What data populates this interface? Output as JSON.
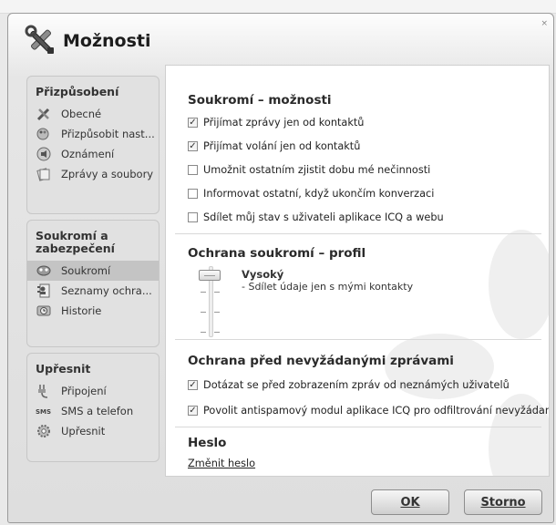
{
  "window": {
    "title": "Možnosti"
  },
  "sidebar": {
    "groups": [
      {
        "title": "Přizpůsobení",
        "items": [
          {
            "label": "Obecné",
            "icon": "tools-icon"
          },
          {
            "label": "Přizpůsobit nast...",
            "icon": "brush-icon"
          },
          {
            "label": "Oznámení",
            "icon": "speaker-icon"
          },
          {
            "label": "Zprávy a soubory",
            "icon": "files-icon"
          }
        ]
      },
      {
        "title": "Soukromí a zabezpečení",
        "items": [
          {
            "label": "Soukromí",
            "icon": "mask-icon",
            "selected": true
          },
          {
            "label": "Seznamy ochra...",
            "icon": "contact-list-icon"
          },
          {
            "label": "Historie",
            "icon": "clock-icon"
          }
        ]
      },
      {
        "title": "Upřesnit",
        "items": [
          {
            "label": "Připojení",
            "icon": "plug-icon"
          },
          {
            "label": "SMS a telefon",
            "icon": "sms-icon"
          },
          {
            "label": "Upřesnit",
            "icon": "gear-icon"
          }
        ]
      }
    ]
  },
  "content": {
    "privacy": {
      "title": "Soukromí – možnosti",
      "options": [
        {
          "label": "Přijímat zprávy jen od kontaktů",
          "checked": true
        },
        {
          "label": "Přijímat volání jen od kontaktů",
          "checked": true
        },
        {
          "label": "Umožnit ostatním zjistit dobu mé nečinnosti",
          "checked": false
        },
        {
          "label": "Informovat ostatní, když ukončím konverzaci",
          "checked": false
        },
        {
          "label": "Sdílet můj stav s uživateli aplikace ICQ a webu",
          "checked": false
        }
      ]
    },
    "profile": {
      "title": "Ochrana soukromí – profil",
      "level_name": "Vysoký",
      "level_desc": "- Sdílet údaje jen s mými kontakty"
    },
    "spam": {
      "title": "Ochrana před nevyžádanými zprávami",
      "options": [
        {
          "label": "Dotázat se před zobrazením zpráv od neznámých uživatelů",
          "checked": true
        },
        {
          "label": "Povolit antispamový modul aplikace ICQ pro odfiltrování nevyžádaný...",
          "checked": true
        }
      ]
    },
    "password": {
      "title": "Heslo",
      "link": "Změnit heslo"
    }
  },
  "buttons": {
    "ok": "OK",
    "cancel": "Storno"
  }
}
